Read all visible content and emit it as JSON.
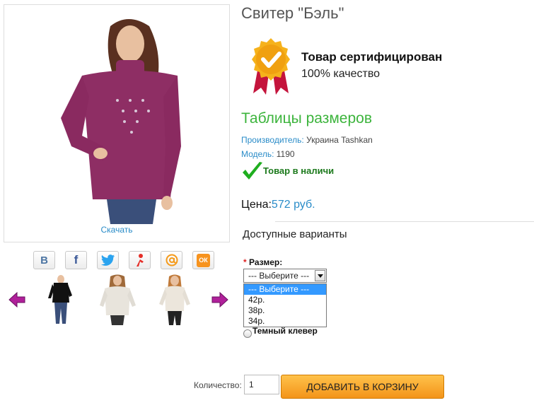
{
  "product": {
    "title": "Свитер \"Бэль\"",
    "download_label": "Скачать"
  },
  "certificate": {
    "title": "Товар сертифицирован",
    "subtitle": "100% качество"
  },
  "size_tables_link": "Таблицы размеров",
  "specs": {
    "manufacturer_label": "Производитель:",
    "manufacturer_value": "Украина Tashkan",
    "model_label": "Модель:",
    "model_value": "1190"
  },
  "stock": "Товар в наличи",
  "price": {
    "label": "Цена:",
    "value": "572 руб."
  },
  "options": {
    "title": "Доступные варианты",
    "size_required_mark": "*",
    "size_label": "Размер:",
    "selected": "--- Выберите ---",
    "items": [
      "--- Выберите ---",
      "42р.",
      "38р.",
      "34р."
    ],
    "color_option": "Темный клевер"
  },
  "quantity": {
    "label": "Количество:",
    "value": "1"
  },
  "add_to_cart": "ДОБАВИТЬ В КОРЗИНУ",
  "share": {
    "vk": "В",
    "fb": "f",
    "ok": "ОК"
  },
  "colors": {
    "accent_blue": "#2a8cc8",
    "green": "#3cb43c",
    "sweater": "#8e2e64",
    "button_orange": "#f3941a"
  }
}
